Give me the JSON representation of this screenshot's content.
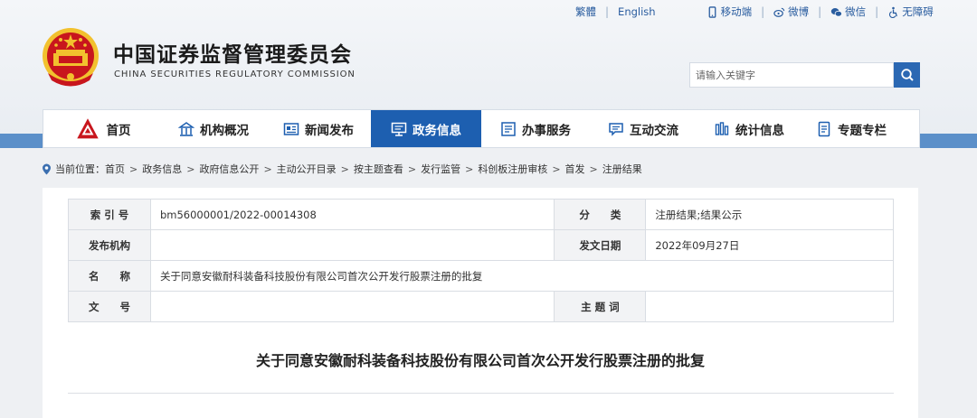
{
  "header": {
    "title": "中国证券监督管理委员会",
    "subtitle": "CHINA SECURITIES REGULATORY COMMISSION"
  },
  "util": {
    "traditional": "繁體",
    "english": "English",
    "mobile": "移动端",
    "weibo": "微博",
    "weixin": "微信",
    "accessible": "无障碍"
  },
  "search": {
    "placeholder": "请输入关键字"
  },
  "nav": [
    {
      "label": "首页",
      "icon": "home-logo-icon"
    },
    {
      "label": "机构概况",
      "icon": "building-icon"
    },
    {
      "label": "新闻发布",
      "icon": "news-icon"
    },
    {
      "label": "政务信息",
      "icon": "monitor-icon",
      "active": true
    },
    {
      "label": "办事服务",
      "icon": "list-icon"
    },
    {
      "label": "互动交流",
      "icon": "chat-icon"
    },
    {
      "label": "统计信息",
      "icon": "bar-chart-icon"
    },
    {
      "label": "专题专栏",
      "icon": "document-icon"
    }
  ],
  "breadcrumb": {
    "prefix": "当前位置：",
    "items": [
      "首页",
      "政务信息",
      "政府信息公开",
      "主动公开目录",
      "按主题查看",
      "发行监管",
      "科创板注册审核",
      "首发",
      "注册结果"
    ]
  },
  "meta": {
    "index_label": "索 引 号",
    "index_value": "bm56000001/2022-00014308",
    "category_label": "分　　类",
    "category_value": "注册结果;结果公示",
    "issuer_label": "发布机构",
    "issuer_value": "",
    "date_label": "发文日期",
    "date_value": "2022年09月27日",
    "name_label": "名　　称",
    "name_value": "关于同意安徽耐科装备科技股份有限公司首次公开发行股票注册的批复",
    "docno_label": "文　　号",
    "docno_value": "",
    "topic_label": "主 题 词",
    "topic_value": ""
  },
  "document": {
    "title": "关于同意安徽耐科装备科技股份有限公司首次公开发行股票注册的批复"
  },
  "colors": {
    "accent": "#1d5fb0",
    "band": "#5b8fc9",
    "link": "#2a5d9f",
    "emblem_red": "#c8161d",
    "emblem_gold": "#f2c12e"
  }
}
